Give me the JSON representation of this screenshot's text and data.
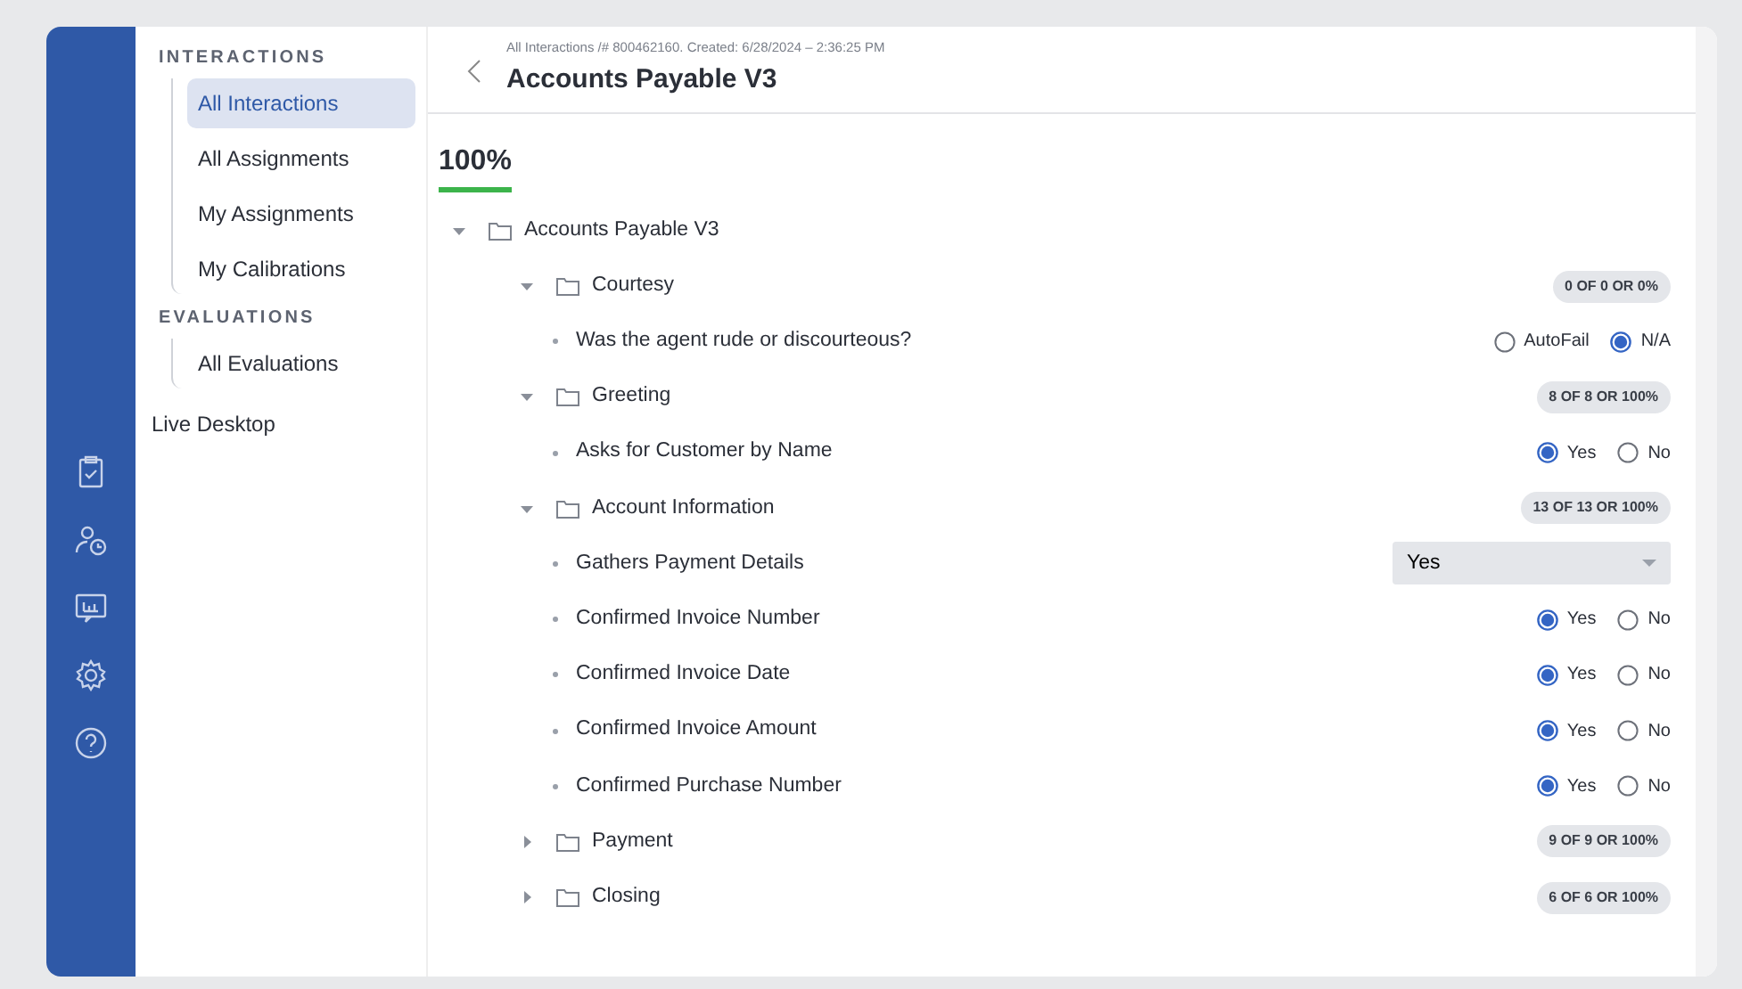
{
  "sidebar": {
    "groups": [
      {
        "heading": "INTERACTIONS",
        "items": [
          {
            "label": "All Interactions",
            "selected": true
          },
          {
            "label": "All Assignments",
            "selected": false
          },
          {
            "label": "My Assignments",
            "selected": false
          },
          {
            "label": "My Calibrations",
            "selected": false
          }
        ]
      },
      {
        "heading": "EVALUATIONS",
        "items": [
          {
            "label": "All Evaluations",
            "selected": false
          }
        ]
      }
    ],
    "links": [
      {
        "label": "Live Desktop",
        "selected": false
      }
    ]
  },
  "header": {
    "breadcrumb": "All Interactions /# 800462160. Created: 6/28/2024 – 2:36:25 PM",
    "title": "Accounts Payable V3"
  },
  "score": "100%",
  "tree": {
    "label": "Accounts Payable V3",
    "expanded": true,
    "children": [
      {
        "label": "Courtesy",
        "expanded": true,
        "badge": "0 OF 0 OR 0%",
        "children": [
          {
            "label": "Was the agent rude or discourteous?",
            "kind": "radio",
            "options": [
              {
                "label": "AutoFail",
                "selected": false
              },
              {
                "label": "N/A",
                "selected": true
              }
            ]
          }
        ]
      },
      {
        "label": "Greeting",
        "expanded": true,
        "badge": "8 OF 8 OR 100%",
        "children": [
          {
            "label": "Asks for Customer by Name",
            "kind": "radio",
            "options": [
              {
                "label": "Yes",
                "selected": true
              },
              {
                "label": "No",
                "selected": false
              }
            ]
          }
        ]
      },
      {
        "label": "Account Information",
        "expanded": true,
        "badge": "13 OF 13 OR 100%",
        "children": [
          {
            "label": "Gathers Payment Details",
            "kind": "select",
            "value": "Yes"
          },
          {
            "label": "Confirmed Invoice Number",
            "kind": "radio",
            "options": [
              {
                "label": "Yes",
                "selected": true
              },
              {
                "label": "No",
                "selected": false
              }
            ]
          },
          {
            "label": "Confirmed Invoice Date",
            "kind": "radio",
            "options": [
              {
                "label": "Yes",
                "selected": true
              },
              {
                "label": "No",
                "selected": false
              }
            ]
          },
          {
            "label": "Confirmed Invoice Amount",
            "kind": "radio",
            "options": [
              {
                "label": "Yes",
                "selected": true
              },
              {
                "label": "No",
                "selected": false
              }
            ]
          },
          {
            "label": "Confirmed Purchase Number",
            "kind": "radio",
            "options": [
              {
                "label": "Yes",
                "selected": true
              },
              {
                "label": "No",
                "selected": false
              }
            ]
          }
        ]
      },
      {
        "label": "Payment",
        "expanded": false,
        "badge": "9 OF 9 OR 100%"
      },
      {
        "label": "Closing",
        "expanded": false,
        "badge": "6 OF 6 OR 100%"
      }
    ]
  }
}
